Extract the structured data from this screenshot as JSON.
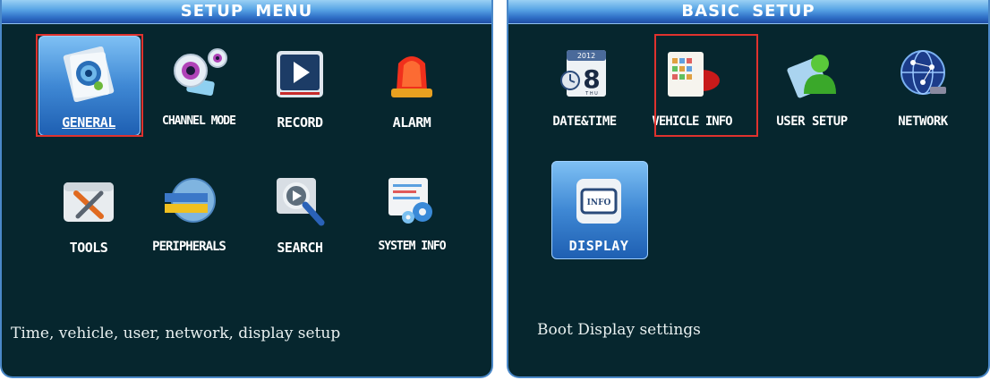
{
  "setup_menu": {
    "title": "SETUP MENU",
    "items": [
      {
        "label": "GENERAL",
        "icon": "general-settings-icon",
        "selected": true
      },
      {
        "label": "CHANNEL MODE",
        "icon": "webcam-icon"
      },
      {
        "label": "RECORD",
        "icon": "record-play-icon"
      },
      {
        "label": "ALARM",
        "icon": "alarm-siren-icon"
      },
      {
        "label": "TOOLS",
        "icon": "tools-icon"
      },
      {
        "label": "PERIPHERALS",
        "icon": "peripherals-globe-icon"
      },
      {
        "label": "SEARCH",
        "icon": "search-magnifier-icon"
      },
      {
        "label": "SYSTEM INFO",
        "icon": "system-info-gears-icon"
      }
    ],
    "description": "Time, vehicle, user, network, display setup"
  },
  "basic_setup": {
    "title": "BASIC SETUP",
    "items": [
      {
        "label": "DATE&TIME",
        "icon": "calendar-clock-icon",
        "calendar_year": "2012",
        "calendar_day": "8",
        "calendar_weekday": "T H U"
      },
      {
        "label": "VEHICLE INFO",
        "icon": "vehicle-info-icon",
        "selected": true
      },
      {
        "label": "USER SETUP",
        "icon": "user-icon"
      },
      {
        "label": "NETWORK",
        "icon": "network-globe-icon"
      },
      {
        "label": "DISPLAY",
        "icon": "display-info-icon",
        "icon_text": "INFO",
        "highlighted": true
      }
    ],
    "description": "Boot Display settings"
  },
  "colors": {
    "background": "#06262e",
    "border": "#4a88c8",
    "selection": "#e0322e",
    "highlight": "#3f88d4"
  }
}
